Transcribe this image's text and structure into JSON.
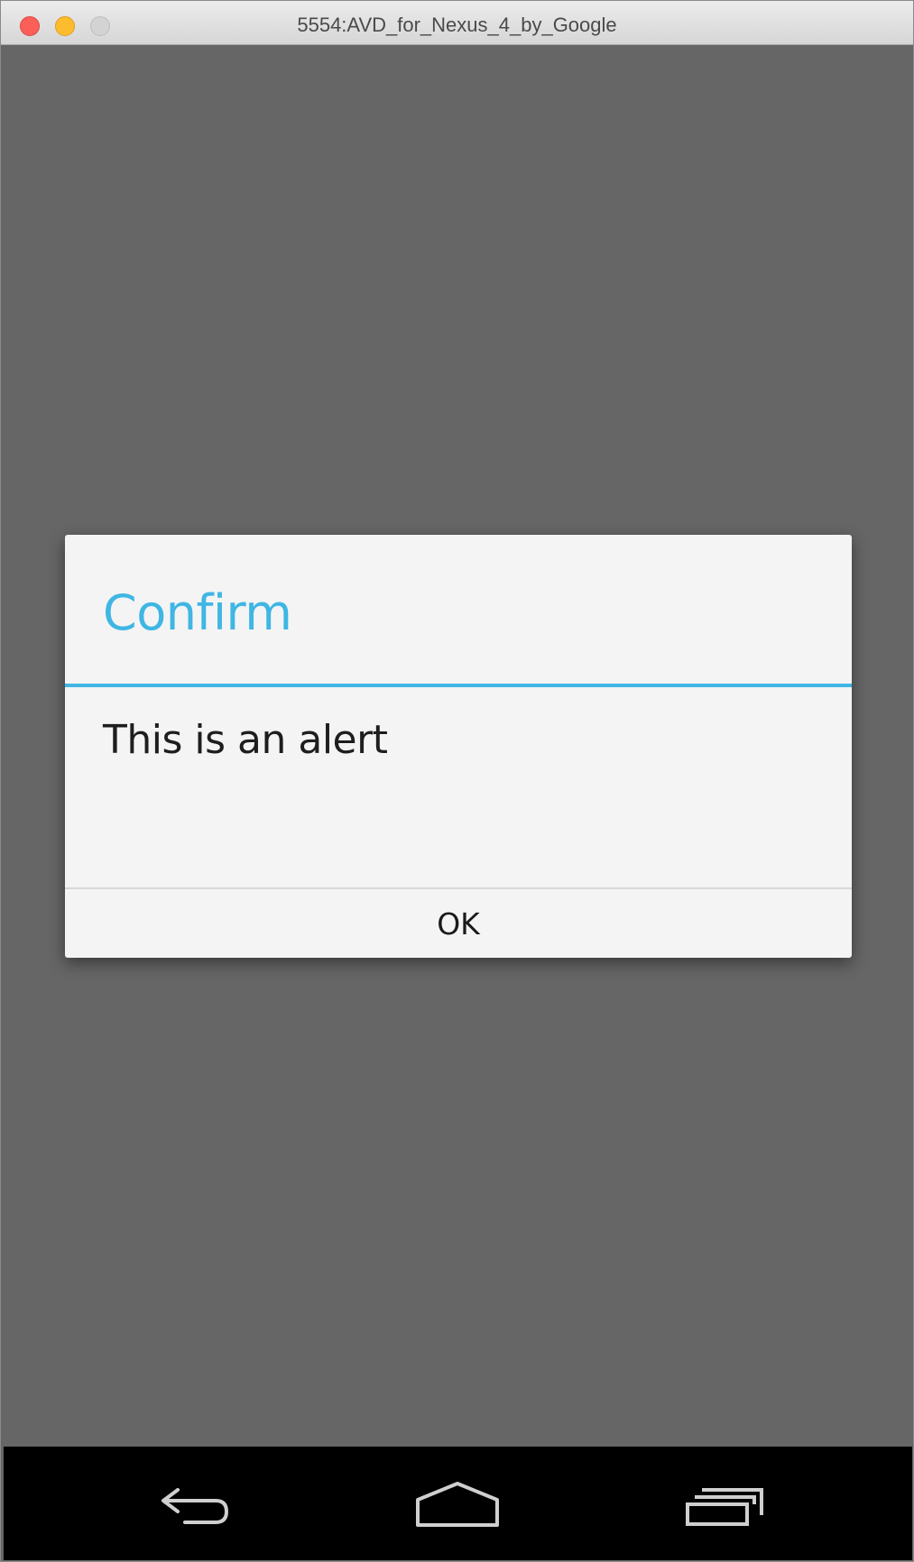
{
  "window": {
    "title": "5554:AVD_for_Nexus_4_by_Google"
  },
  "dialog": {
    "title": "Confirm",
    "message": "This is an alert",
    "ok_label": "OK"
  },
  "colors": {
    "accent": "#3fb6e4",
    "dim_background": "#666666",
    "dialog_background": "#f4f4f4",
    "navbar": "#000000"
  },
  "navbar": {
    "icons": [
      "back-icon",
      "home-icon",
      "recent-apps-icon"
    ]
  }
}
